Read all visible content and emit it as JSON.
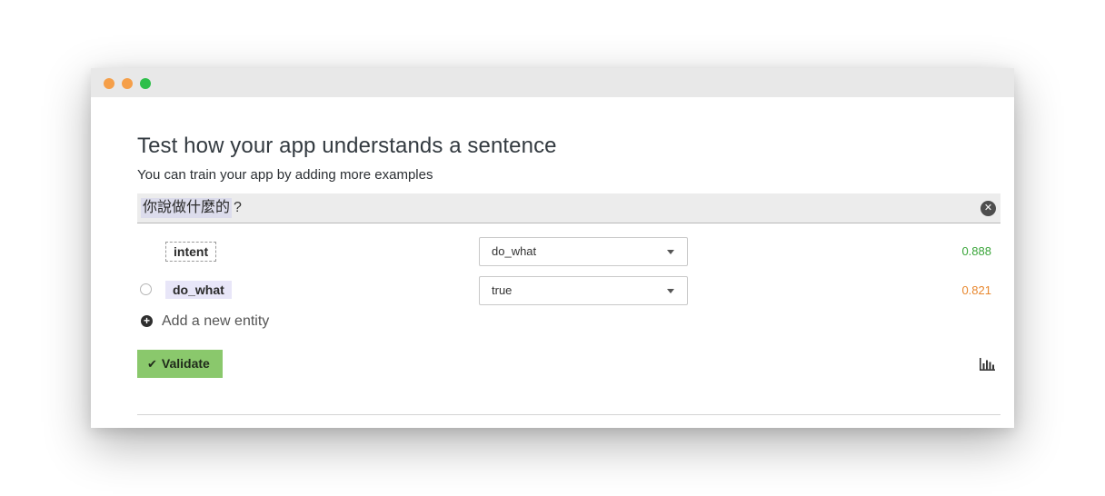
{
  "window": {
    "controls": [
      "close",
      "minimize",
      "zoom"
    ],
    "colors": {
      "close": "#f59f49",
      "minimize": "#f59f49",
      "zoom": "#2ebf4a"
    }
  },
  "header": {
    "title": "Test how your app understands a sentence",
    "subtitle": "You can train your app by adding more examples"
  },
  "sentence": {
    "highlighted_text": "你說做什麼的",
    "trailing_text": "?",
    "clear_icon": "close-circle-icon"
  },
  "rows": [
    {
      "label": "intent",
      "value": "do_what",
      "score": "0.888",
      "score_color": "#3aa53a"
    },
    {
      "label": "do_what",
      "value": "true",
      "score": "0.821",
      "score_color": "#e8872e"
    }
  ],
  "add_entity": {
    "label": "Add a new entity",
    "icon": "plus-circle-icon"
  },
  "validate": {
    "label": "Validate",
    "icon": "check-icon",
    "color": "#8ac86c"
  },
  "chart_icon": "bar-chart-icon"
}
